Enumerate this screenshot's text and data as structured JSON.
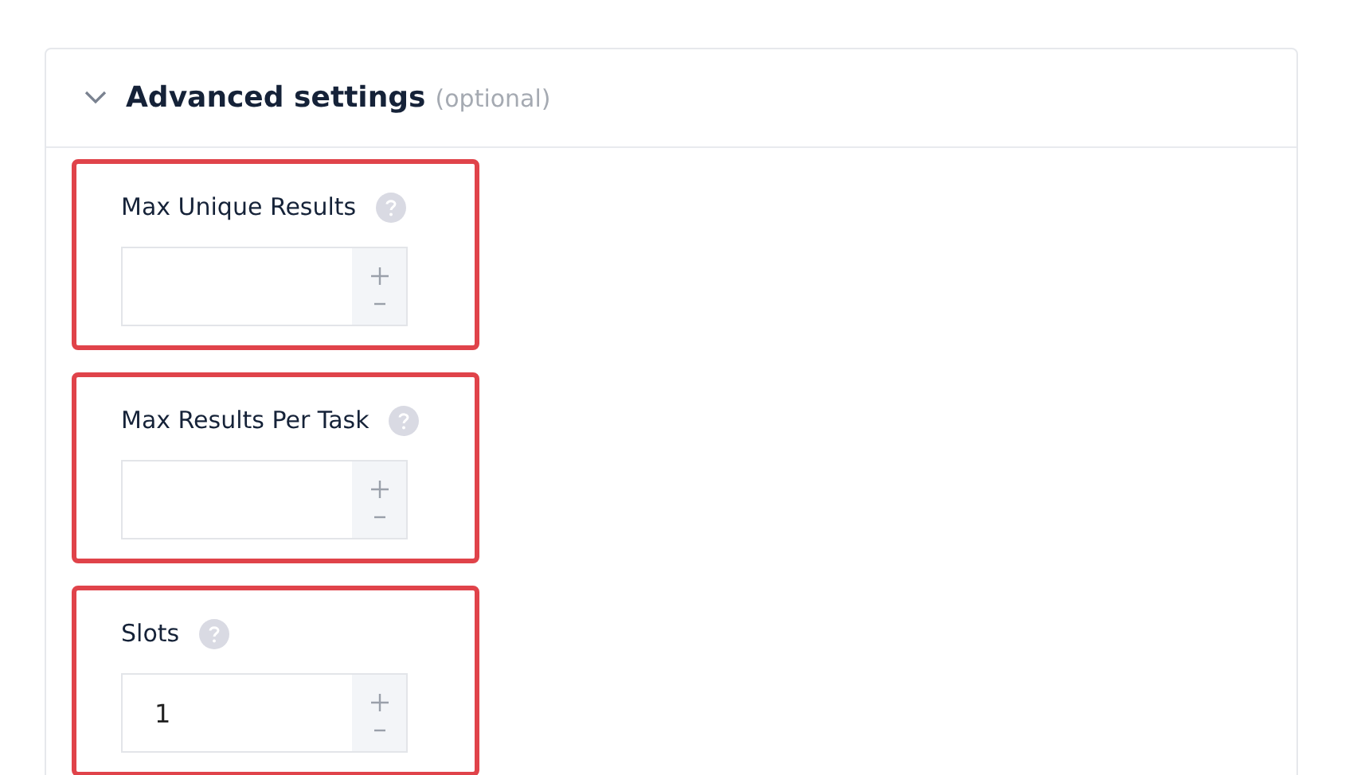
{
  "section": {
    "title": "Advanced settings",
    "hint": "(optional)",
    "expanded": true
  },
  "fields": [
    {
      "label": "Max Unique Results",
      "highlighted": true
    },
    {
      "label": "Max Results Per Task",
      "highlighted": true
    },
    {
      "label": "Slots",
      "value": "1",
      "highlighted": true
    }
  ]
}
